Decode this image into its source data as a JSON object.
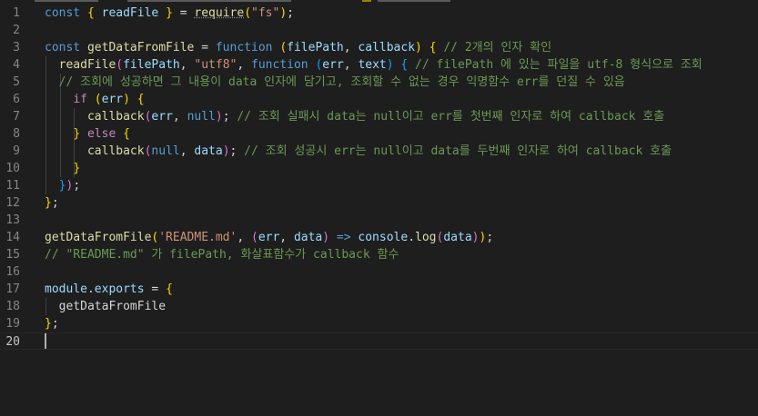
{
  "editor": {
    "lines": [
      {
        "n": "1",
        "tokens": [
          {
            "t": "const",
            "c": "kw"
          },
          {
            "t": " ",
            "c": "p"
          },
          {
            "t": "{",
            "c": "br1"
          },
          {
            "t": " ",
            "c": "p"
          },
          {
            "t": "readFile",
            "c": "var"
          },
          {
            "t": " ",
            "c": "p"
          },
          {
            "t": "}",
            "c": "br1"
          },
          {
            "t": " = ",
            "c": "p"
          },
          {
            "t": "require",
            "c": "fn squiggle"
          },
          {
            "t": "(",
            "c": "br1"
          },
          {
            "t": "\"fs\"",
            "c": "str"
          },
          {
            "t": ")",
            "c": "br1"
          },
          {
            "t": ";",
            "c": "p"
          }
        ]
      },
      {
        "n": "2",
        "tokens": []
      },
      {
        "n": "3",
        "tokens": [
          {
            "t": "const",
            "c": "kw"
          },
          {
            "t": " ",
            "c": "p"
          },
          {
            "t": "getDataFromFile",
            "c": "fn"
          },
          {
            "t": " = ",
            "c": "p"
          },
          {
            "t": "function",
            "c": "kw"
          },
          {
            "t": " ",
            "c": "p"
          },
          {
            "t": "(",
            "c": "br1"
          },
          {
            "t": "filePath",
            "c": "var"
          },
          {
            "t": ", ",
            "c": "p"
          },
          {
            "t": "callback",
            "c": "var"
          },
          {
            "t": ")",
            "c": "br1"
          },
          {
            "t": " ",
            "c": "p"
          },
          {
            "t": "{",
            "c": "br1"
          },
          {
            "t": " // 2개의 인자 확인",
            "c": "cm"
          }
        ]
      },
      {
        "n": "4",
        "tokens": [
          {
            "t": "  ",
            "c": "p"
          },
          {
            "t": "readFile",
            "c": "fn"
          },
          {
            "t": "(",
            "c": "br2"
          },
          {
            "t": "filePath",
            "c": "var"
          },
          {
            "t": ", ",
            "c": "p"
          },
          {
            "t": "\"utf8\"",
            "c": "str"
          },
          {
            "t": ", ",
            "c": "p"
          },
          {
            "t": "function",
            "c": "kw"
          },
          {
            "t": " ",
            "c": "p"
          },
          {
            "t": "(",
            "c": "br3"
          },
          {
            "t": "err",
            "c": "var"
          },
          {
            "t": ", ",
            "c": "p"
          },
          {
            "t": "text",
            "c": "var"
          },
          {
            "t": ")",
            "c": "br3"
          },
          {
            "t": " ",
            "c": "p"
          },
          {
            "t": "{",
            "c": "br3"
          },
          {
            "t": " // filePath 에 있는 파일을 utf-8 형식으로 조회",
            "c": "cm"
          }
        ]
      },
      {
        "n": "5",
        "tokens": [
          {
            "t": "  // 조회에 성공하면 그 내용이 data 인자에 담기고, 조회할 수 없는 경우 익명함수 err를 던질 수 있음",
            "c": "cm"
          }
        ]
      },
      {
        "n": "6",
        "tokens": [
          {
            "t": "    ",
            "c": "p"
          },
          {
            "t": "if",
            "c": "ctl"
          },
          {
            "t": " ",
            "c": "p"
          },
          {
            "t": "(",
            "c": "br1"
          },
          {
            "t": "err",
            "c": "var"
          },
          {
            "t": ")",
            "c": "br1"
          },
          {
            "t": " ",
            "c": "p"
          },
          {
            "t": "{",
            "c": "br1"
          }
        ]
      },
      {
        "n": "7",
        "tokens": [
          {
            "t": "      ",
            "c": "p"
          },
          {
            "t": "callback",
            "c": "fn"
          },
          {
            "t": "(",
            "c": "br2"
          },
          {
            "t": "err",
            "c": "var"
          },
          {
            "t": ", ",
            "c": "p"
          },
          {
            "t": "null",
            "c": "kw"
          },
          {
            "t": ")",
            "c": "br2"
          },
          {
            "t": ";",
            "c": "p"
          },
          {
            "t": " // 조회 실패시 data는 null이고 err를 첫번째 인자로 하여 callback 호출",
            "c": "cm"
          }
        ]
      },
      {
        "n": "8",
        "tokens": [
          {
            "t": "    ",
            "c": "p"
          },
          {
            "t": "}",
            "c": "br1"
          },
          {
            "t": " ",
            "c": "p"
          },
          {
            "t": "else",
            "c": "ctl"
          },
          {
            "t": " ",
            "c": "p"
          },
          {
            "t": "{",
            "c": "br1"
          }
        ]
      },
      {
        "n": "9",
        "tokens": [
          {
            "t": "      ",
            "c": "p"
          },
          {
            "t": "callback",
            "c": "fn"
          },
          {
            "t": "(",
            "c": "br2"
          },
          {
            "t": "null",
            "c": "kw"
          },
          {
            "t": ", ",
            "c": "p"
          },
          {
            "t": "data",
            "c": "var"
          },
          {
            "t": ")",
            "c": "br2"
          },
          {
            "t": ";",
            "c": "p"
          },
          {
            "t": " // 조회 성공시 err는 null이고 data를 두번째 인자로 하여 callback 호출",
            "c": "cm"
          }
        ]
      },
      {
        "n": "10",
        "tokens": [
          {
            "t": "    ",
            "c": "p"
          },
          {
            "t": "}",
            "c": "br1"
          }
        ]
      },
      {
        "n": "11",
        "tokens": [
          {
            "t": "  ",
            "c": "p"
          },
          {
            "t": "}",
            "c": "br3"
          },
          {
            "t": ")",
            "c": "br2"
          },
          {
            "t": ";",
            "c": "p"
          }
        ]
      },
      {
        "n": "12",
        "tokens": [
          {
            "t": "}",
            "c": "br1"
          },
          {
            "t": ";",
            "c": "p"
          }
        ]
      },
      {
        "n": "13",
        "tokens": []
      },
      {
        "n": "14",
        "tokens": [
          {
            "t": "getDataFromFile",
            "c": "fn"
          },
          {
            "t": "(",
            "c": "br1"
          },
          {
            "t": "'README.md'",
            "c": "str"
          },
          {
            "t": ", ",
            "c": "p"
          },
          {
            "t": "(",
            "c": "br2"
          },
          {
            "t": "err",
            "c": "var"
          },
          {
            "t": ", ",
            "c": "p"
          },
          {
            "t": "data",
            "c": "var"
          },
          {
            "t": ")",
            "c": "br2"
          },
          {
            "t": " ",
            "c": "p"
          },
          {
            "t": "=>",
            "c": "kw"
          },
          {
            "t": " ",
            "c": "p"
          },
          {
            "t": "console",
            "c": "var"
          },
          {
            "t": ".",
            "c": "p"
          },
          {
            "t": "log",
            "c": "fn"
          },
          {
            "t": "(",
            "c": "br2"
          },
          {
            "t": "data",
            "c": "var"
          },
          {
            "t": ")",
            "c": "br2"
          },
          {
            "t": ")",
            "c": "br1"
          },
          {
            "t": ";",
            "c": "p"
          }
        ]
      },
      {
        "n": "15",
        "tokens": [
          {
            "t": "// \"README.md\" 가 filePath, 화살표함수가 callback 함수",
            "c": "cm"
          }
        ]
      },
      {
        "n": "16",
        "tokens": []
      },
      {
        "n": "17",
        "tokens": [
          {
            "t": "module",
            "c": "var"
          },
          {
            "t": ".",
            "c": "p"
          },
          {
            "t": "exports",
            "c": "var"
          },
          {
            "t": " = ",
            "c": "p"
          },
          {
            "t": "{",
            "c": "br1"
          }
        ]
      },
      {
        "n": "18",
        "tokens": [
          {
            "t": "  ",
            "c": "p"
          },
          {
            "t": "getDataFromFile",
            "c": "p"
          }
        ]
      },
      {
        "n": "19",
        "tokens": [
          {
            "t": "}",
            "c": "br1"
          },
          {
            "t": ";",
            "c": "p"
          }
        ]
      },
      {
        "n": "20",
        "tokens": [],
        "active": true
      }
    ]
  }
}
